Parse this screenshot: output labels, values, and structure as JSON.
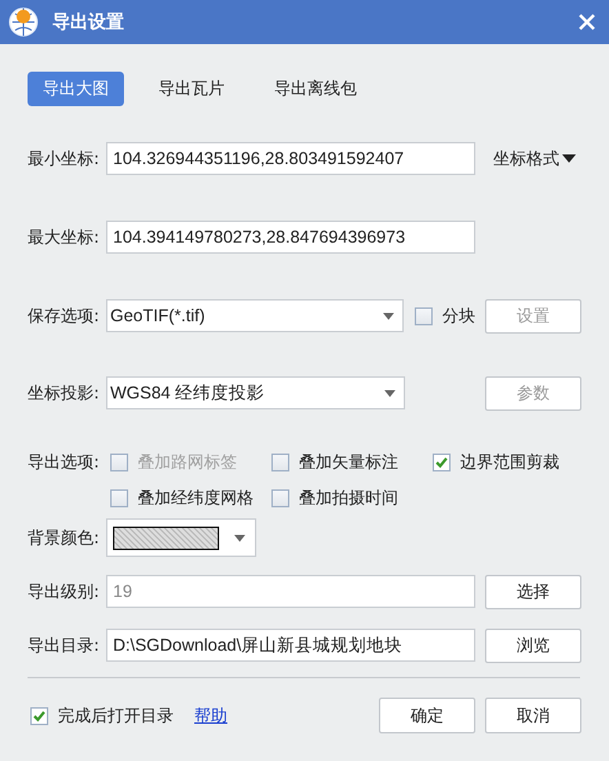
{
  "window": {
    "title": "导出设置"
  },
  "tabs": [
    {
      "label": "导出大图",
      "selected": true
    },
    {
      "label": "导出瓦片",
      "selected": false
    },
    {
      "label": "导出离线包",
      "selected": false
    }
  ],
  "min_coord": {
    "label": "最小坐标:",
    "value": "104.326944351196,28.803491592407",
    "menu": "坐标格式"
  },
  "max_coord": {
    "label": "最大坐标:",
    "value": "104.394149780273,28.847694396973"
  },
  "save_option": {
    "label": "保存选项:",
    "value": "GeoTIF(*.tif)",
    "tile": {
      "label": "分块",
      "checked": false
    },
    "button": {
      "label": "设置",
      "disabled": true
    }
  },
  "projection": {
    "label": "坐标投影:",
    "value": "WGS84 经纬度投影",
    "button": {
      "label": "参数",
      "disabled": true
    }
  },
  "export_options": {
    "label": "导出选项:",
    "items": [
      {
        "label": "叠加路网标签",
        "checked": false,
        "disabled": true
      },
      {
        "label": "叠加矢量标注",
        "checked": false,
        "disabled": false
      },
      {
        "label": "边界范围剪裁",
        "checked": true,
        "disabled": false
      },
      {
        "label": "叠加经纬度网格",
        "checked": false,
        "disabled": false
      },
      {
        "label": "叠加拍摄时间",
        "checked": false,
        "disabled": false
      }
    ]
  },
  "background_color": {
    "label": "背景颜色:"
  },
  "export_level": {
    "label": "导出级别:",
    "value": "19",
    "disabled": true,
    "button": {
      "label": "选择",
      "disabled": false
    }
  },
  "export_dir": {
    "label": "导出目录:",
    "value": "D:\\SGDownload\\屏山新县城规划地块",
    "button": {
      "label": "浏览",
      "disabled": false
    }
  },
  "footer": {
    "open_after": {
      "label": "完成后打开目录",
      "checked": true
    },
    "help": "帮助",
    "buttons": [
      {
        "label": "确定"
      },
      {
        "label": "取消"
      }
    ]
  }
}
